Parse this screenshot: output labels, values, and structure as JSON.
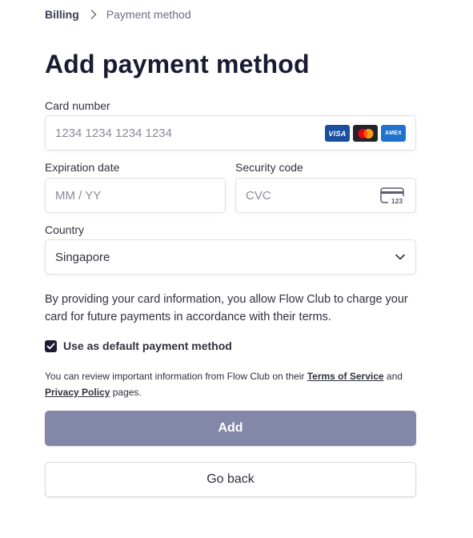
{
  "breadcrumb": {
    "parent": "Billing",
    "current": "Payment method"
  },
  "title": "Add payment method",
  "card_number": {
    "label": "Card number",
    "placeholder": "1234 1234 1234 1234",
    "brands": [
      "VISA",
      "Mastercard",
      "AMEX"
    ]
  },
  "expiration": {
    "label": "Expiration date",
    "placeholder": "MM / YY"
  },
  "security_code": {
    "label": "Security code",
    "placeholder": "CVC",
    "icon_text": "123"
  },
  "country": {
    "label": "Country",
    "value": "Singapore"
  },
  "consent_text": "By providing your card information, you allow Flow Club to charge your card for future payments in accordance with their terms.",
  "default_payment": {
    "checked": true,
    "label": "Use as default payment method"
  },
  "legal": {
    "prefix": "You can review important information from Flow Club on their",
    "terms_link": "Terms of Service",
    "and": "and",
    "privacy_link": "Privacy Policy",
    "suffix": "pages."
  },
  "buttons": {
    "add": "Add",
    "back": "Go back"
  },
  "colors": {
    "add_button_bg": "#8387a8",
    "checkbox_bg": "#1a1b33",
    "title_color": "#1a1b33"
  }
}
